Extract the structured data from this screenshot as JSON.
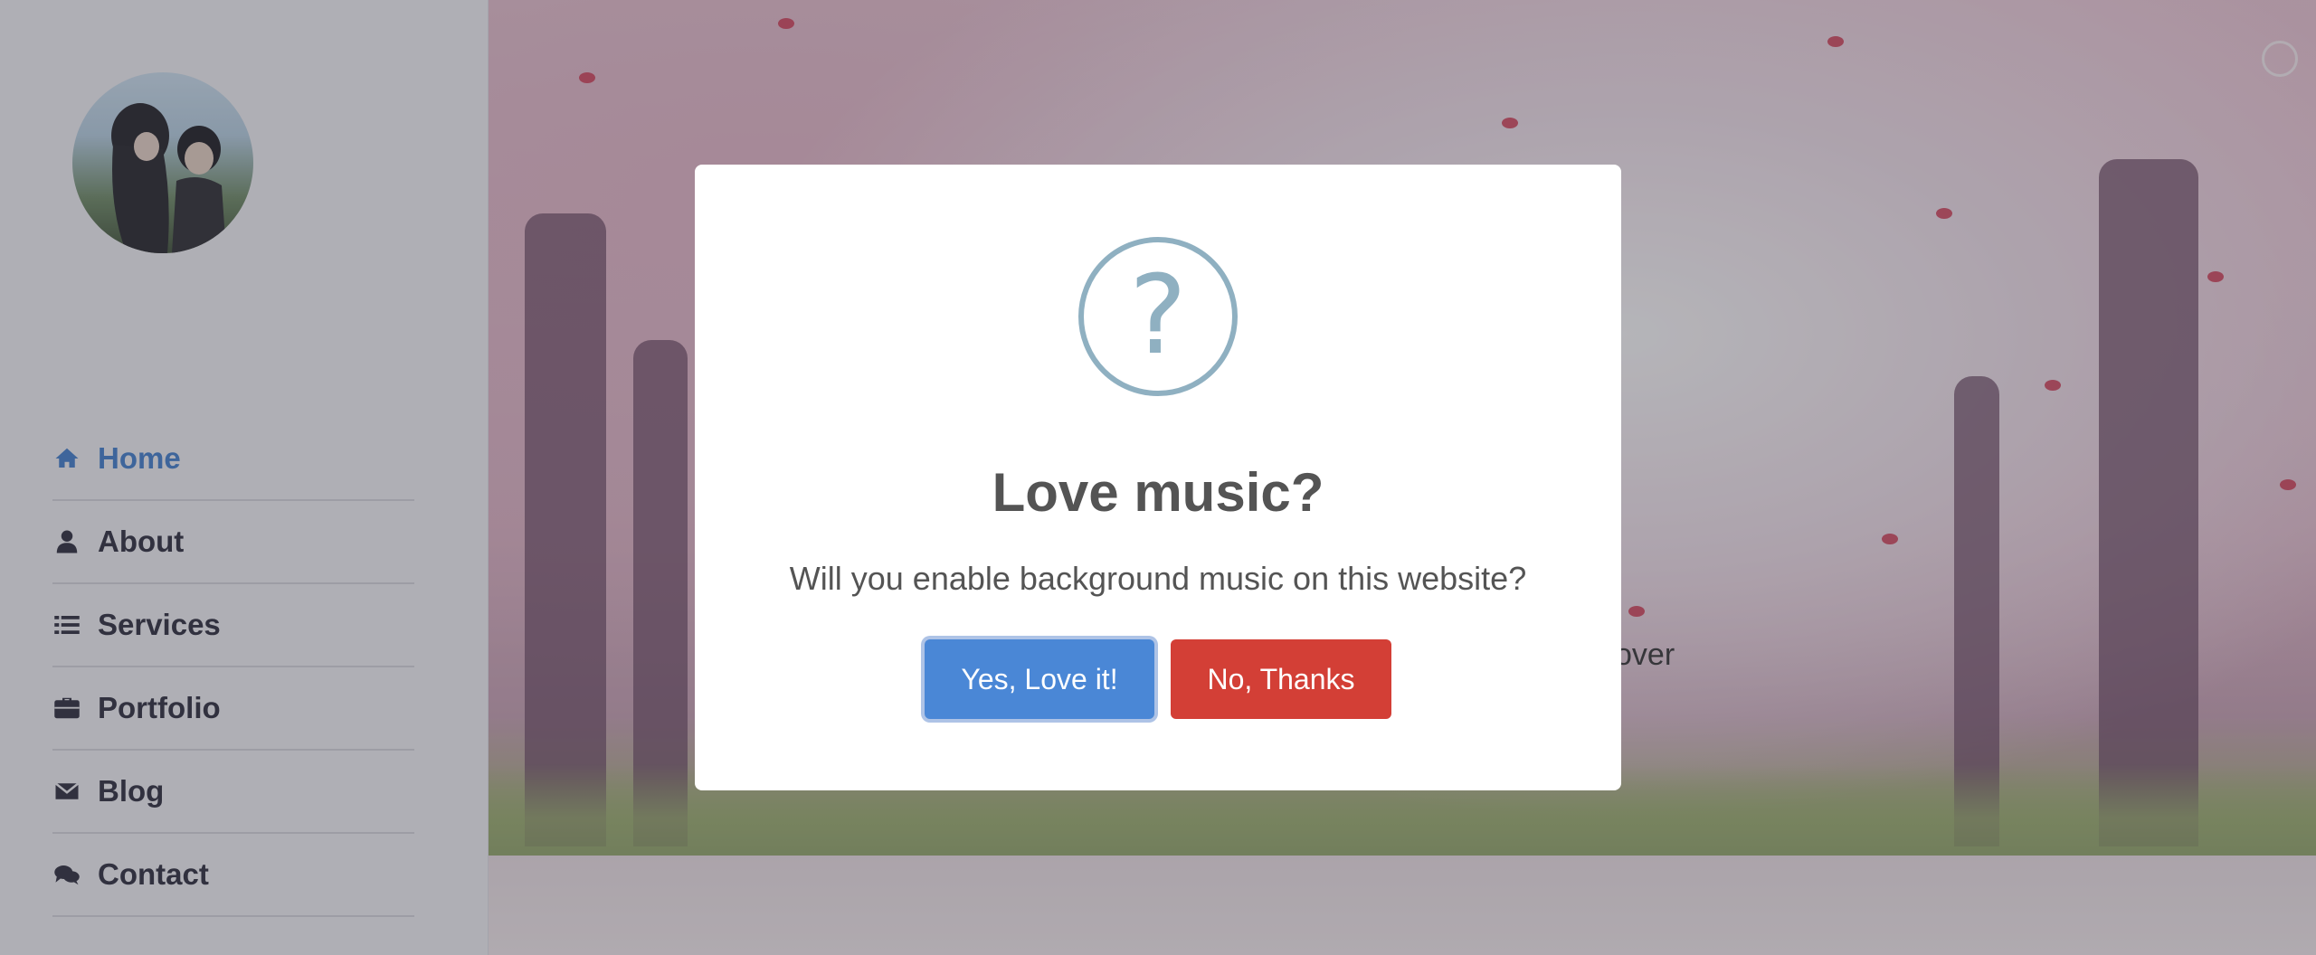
{
  "sidebar": {
    "avatar_icon": "profile-avatar",
    "nav": [
      {
        "label": "Home",
        "icon": "home-icon",
        "active": true
      },
      {
        "label": "About",
        "icon": "user-icon",
        "active": false
      },
      {
        "label": "Services",
        "icon": "list-icon",
        "active": false
      },
      {
        "label": "Portfolio",
        "icon": "briefcase-icon",
        "active": false
      },
      {
        "label": "Blog",
        "icon": "envelope-icon",
        "active": false
      },
      {
        "label": "Contact",
        "icon": "comments-icon",
        "active": false
      }
    ]
  },
  "hero": {
    "partial_text": "over"
  },
  "modal": {
    "icon": "question-icon",
    "icon_glyph": "?",
    "title": "Love music?",
    "text": "Will you enable background music on this website?",
    "confirm_label": "Yes, Love it!",
    "cancel_label": "No, Thanks"
  },
  "colors": {
    "accent": "#3f7fcf",
    "confirm": "#4a87d6",
    "cancel": "#d33f36",
    "modal_icon": "#8fb0c1"
  }
}
